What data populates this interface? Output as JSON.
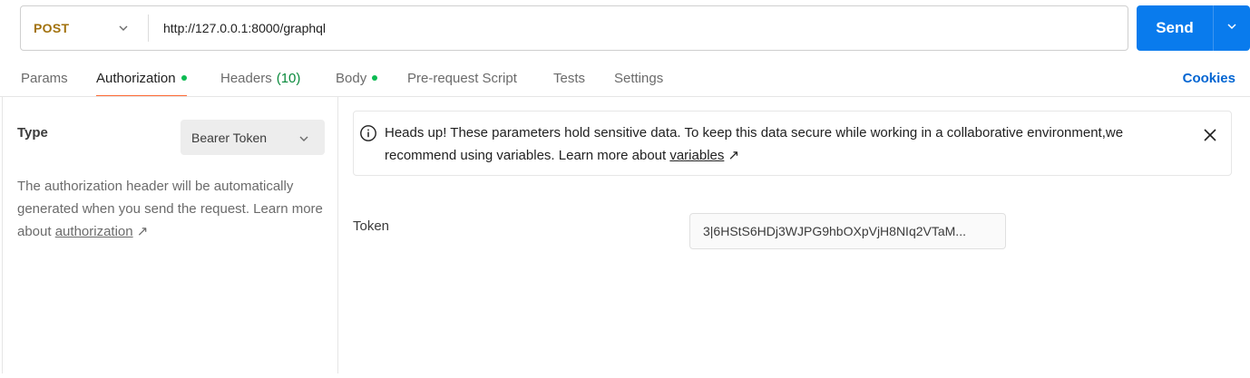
{
  "request": {
    "method": "POST",
    "url": "http://127.0.0.1:8000/graphql",
    "send_label": "Send"
  },
  "tabs": [
    {
      "label": "Params",
      "active": false
    },
    {
      "label": "Authorization",
      "active": true,
      "dot": true
    },
    {
      "label": "Headers",
      "count": "(10)",
      "active": false
    },
    {
      "label": "Body",
      "active": false,
      "dot": true
    },
    {
      "label": "Pre-request Script",
      "active": false
    },
    {
      "label": "Tests",
      "active": false
    },
    {
      "label": "Settings",
      "active": false
    }
  ],
  "cookies_label": "Cookies",
  "auth": {
    "type_label": "Type",
    "type_value": "Bearer Token",
    "help_text": "The authorization header will be automatically generated when you send the request. Learn more about",
    "help_link": "authorization",
    "link_arrow": "↗"
  },
  "banner": {
    "text": "Heads up! These parameters hold sensitive data. To keep this data secure while working in a collaborative environment,we recommend using variables. Learn more about",
    "link": "variables",
    "link_arrow": "↗"
  },
  "token": {
    "label": "Token",
    "value": "3|6HStS6HDj3WJPG9hbOXpVjH8NIq2VTaM..."
  },
  "colors": {
    "accent": "#ff6c37",
    "send": "#097bed",
    "method": "#a2720e",
    "dot": "#0cbb52",
    "link": "#0265d2"
  }
}
